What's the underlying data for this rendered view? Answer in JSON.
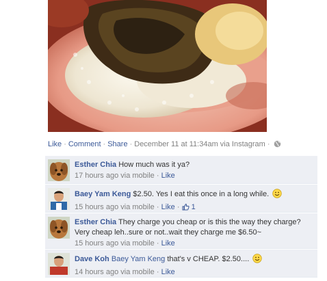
{
  "post": {
    "photo_alt": "",
    "actions": {
      "like": "Like",
      "comment": "Comment",
      "share": "Share",
      "sep": "·",
      "timestamp": "December 11 at 11:34am via Instagram"
    }
  },
  "comments": [
    {
      "author": "Esther Chia",
      "text": "How much was it ya?",
      "time": "17 hours ago via mobile",
      "like": "Like"
    },
    {
      "author": "Baey Yam Keng",
      "text": "$2.50. Yes I eat this once in a long while.",
      "time": "15 hours ago via mobile",
      "like": "Like",
      "like_count": "1"
    },
    {
      "author": "Esther Chia",
      "text": "They charge you cheap or is this the way they charge? Very cheap leh..sure or not..wait they charge me $6.50~",
      "time": "15 hours ago via mobile",
      "like": "Like"
    },
    {
      "author": "Dave Koh",
      "mention": "Baey Yam Keng",
      "text": "that's v CHEAP. $2.50....",
      "time": "14 hours ago via mobile",
      "like": "Like"
    }
  ],
  "colors": {
    "link": "#3b5998",
    "comment_bg": "#edeff4",
    "meta": "#808080"
  }
}
